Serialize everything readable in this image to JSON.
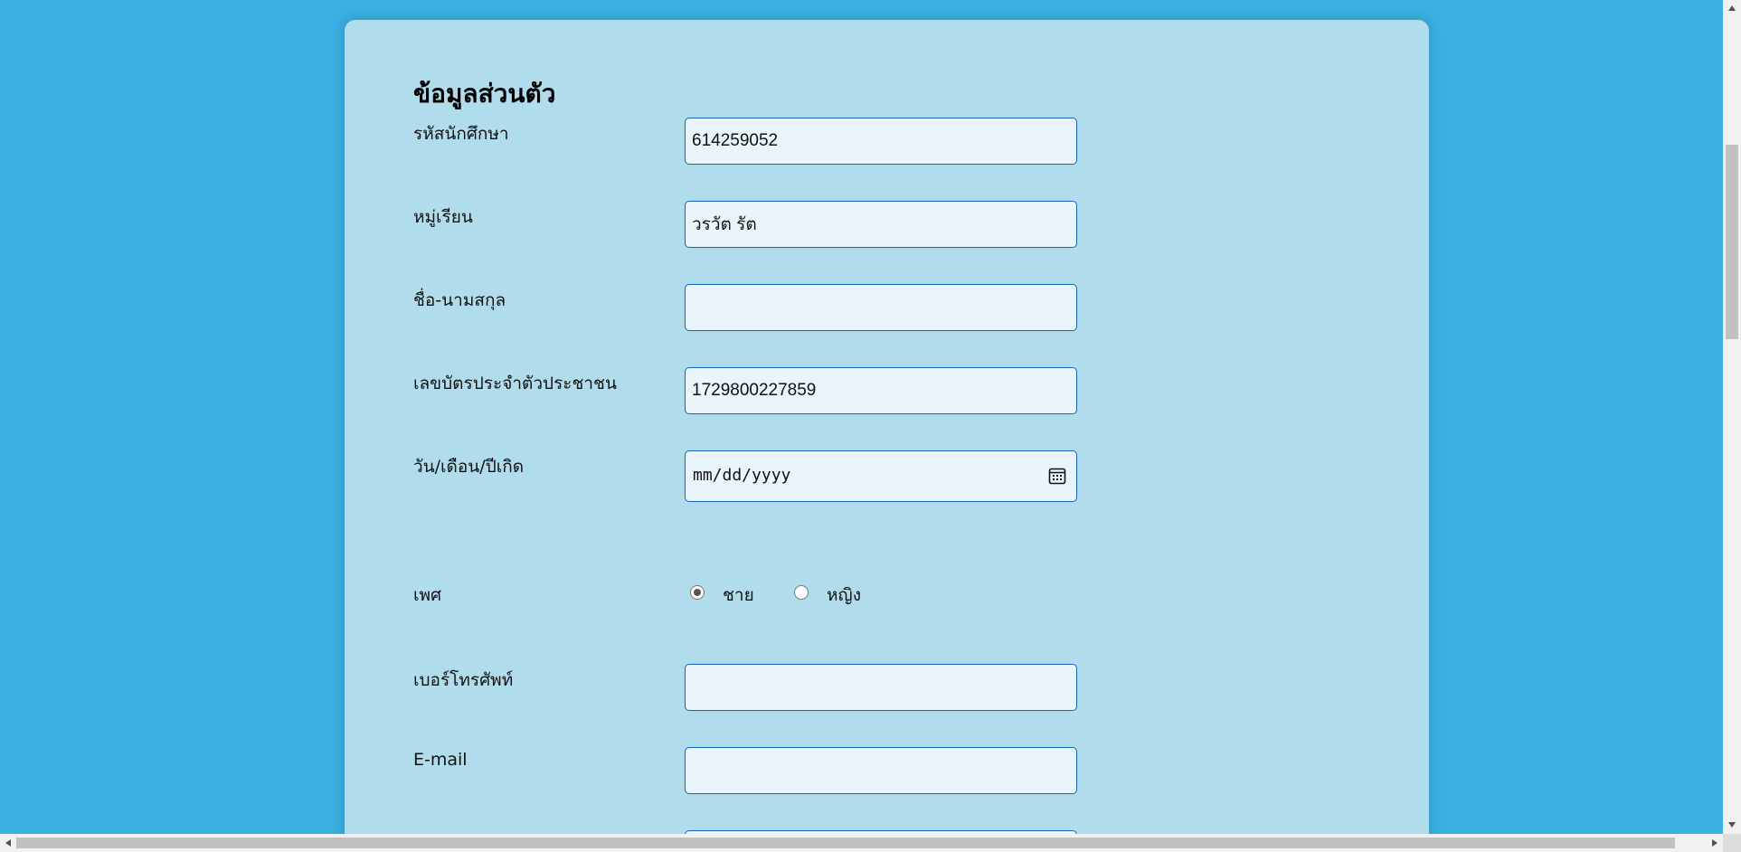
{
  "form": {
    "title": "ข้อมูลส่วนตัว",
    "fields": [
      {
        "label": "รหัสนักศึกษา",
        "value": "614259052",
        "placeholder": ""
      },
      {
        "label": "หมู่เรียน",
        "value": "วรวัต รัต",
        "placeholder": ""
      },
      {
        "label": "ชื่อ-นามสกุล",
        "value": "",
        "placeholder": ""
      },
      {
        "label": "เลขบัตรประจำตัวประชาชน",
        "value": "1729800227859",
        "placeholder": ""
      }
    ],
    "birthdate": {
      "label": "วัน/เดือน/ปีเกิด",
      "value": "mm/dd/yyyy"
    },
    "gender": {
      "label": "เพศ",
      "options": [
        {
          "label": "ชาย",
          "checked": true
        },
        {
          "label": "หญิง",
          "checked": false
        }
      ]
    },
    "phone": {
      "label": "เบอร์โทรศัพท์",
      "value": ""
    },
    "email": {
      "label": "E-mail",
      "value": ""
    }
  },
  "colors": {
    "page_background": "#3aafe2",
    "card_background": "#b1dcec",
    "input_border": "#1a63b8",
    "input_background": "#eaf4fb"
  }
}
